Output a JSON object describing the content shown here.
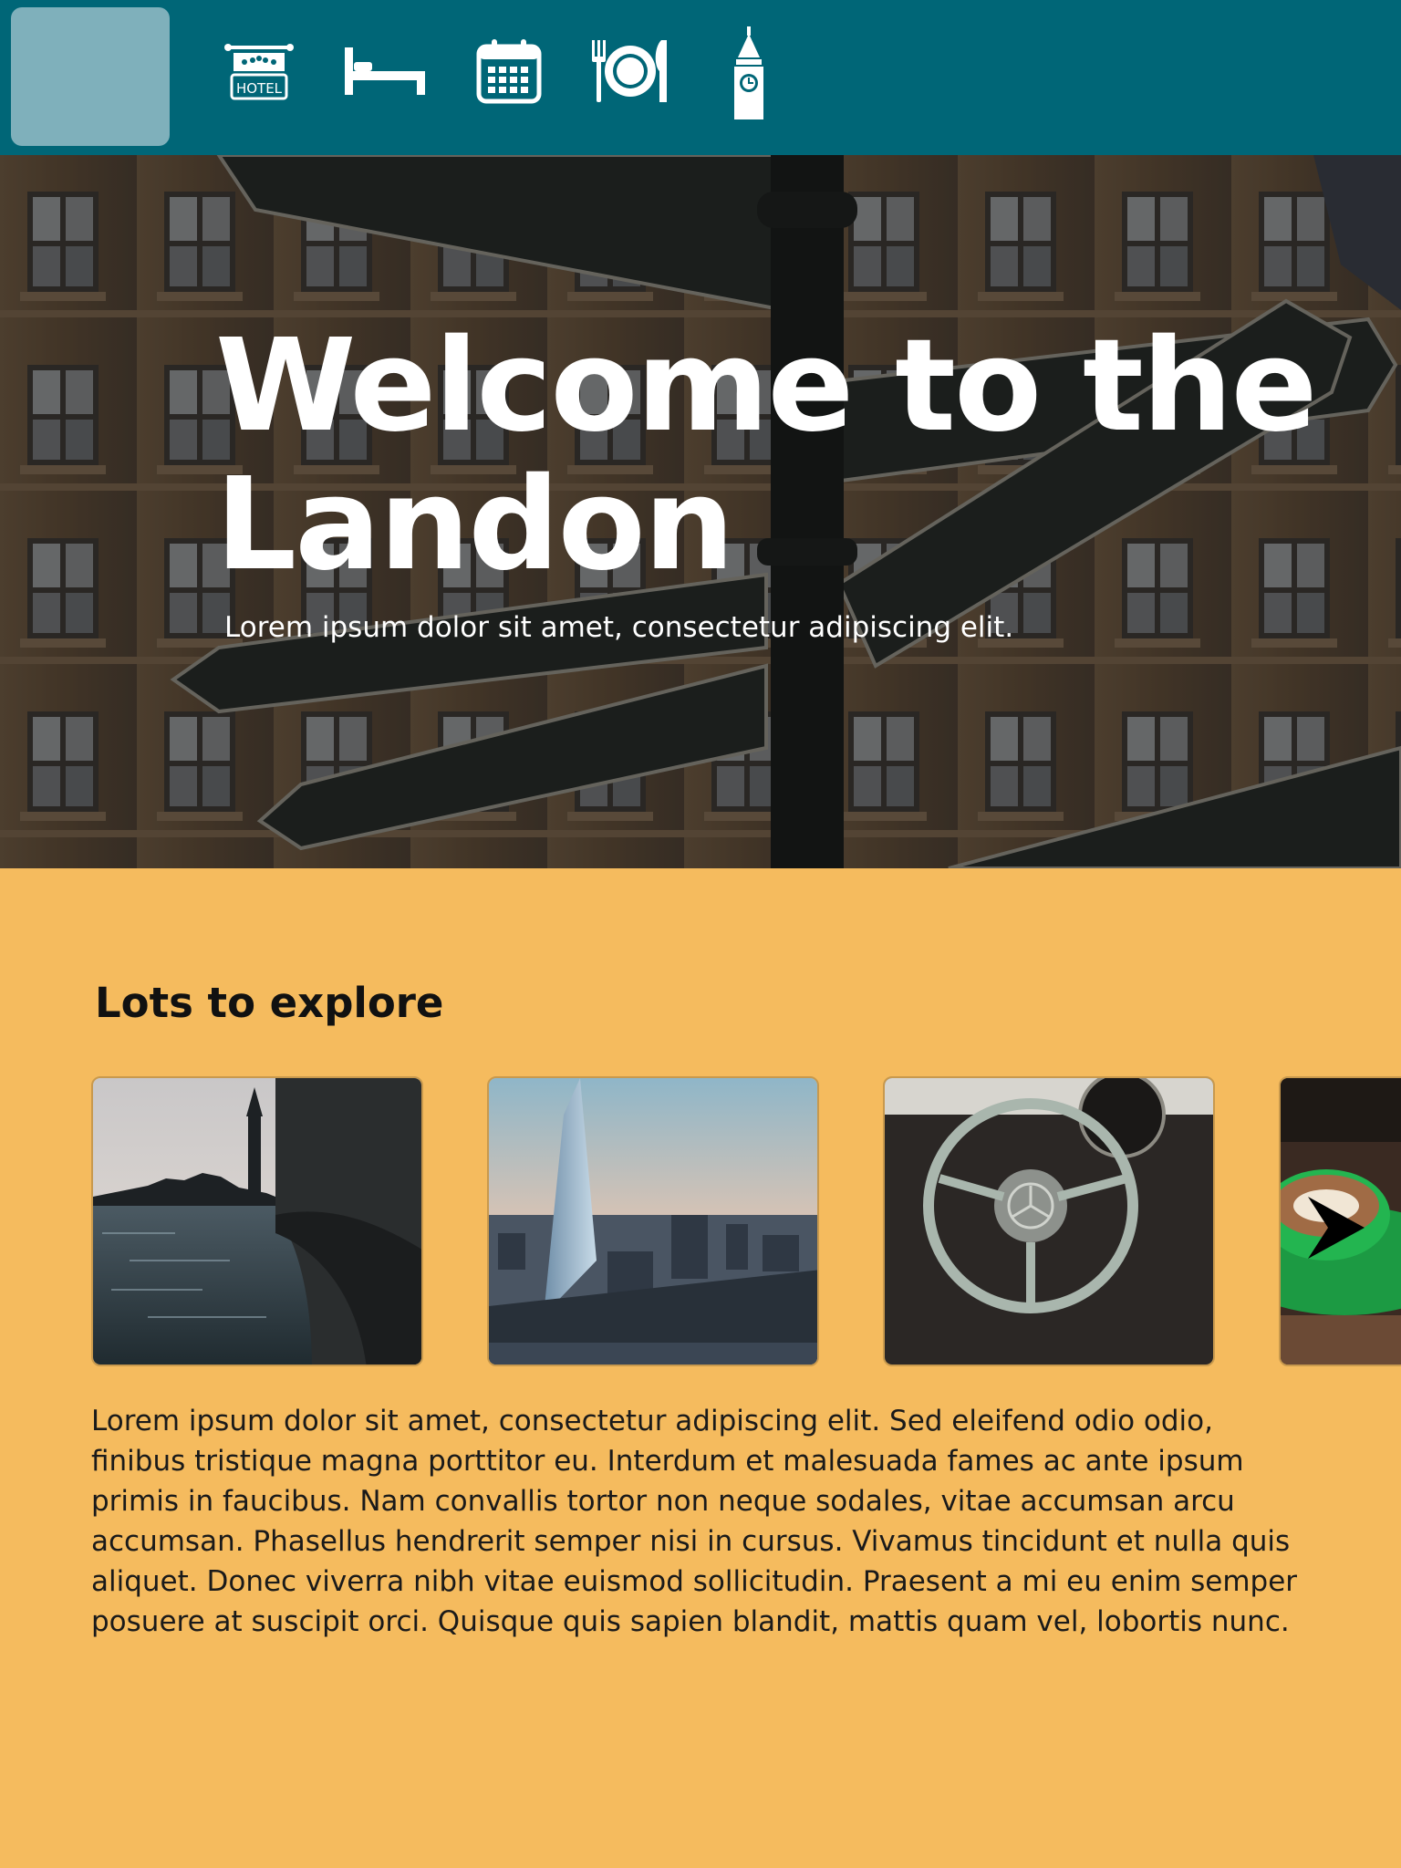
{
  "nav": {
    "icons": [
      {
        "name": "hotel-icon",
        "label": "HOTEL"
      },
      {
        "name": "bed-icon"
      },
      {
        "name": "calendar-icon"
      },
      {
        "name": "dining-icon"
      },
      {
        "name": "big-ben-icon"
      }
    ],
    "colors": {
      "bar": "#006677",
      "logo_placeholder": "#7fb0bb",
      "icon": "#ffffff"
    }
  },
  "hero": {
    "title": "Welcome to the Landon",
    "subtitle": "Lorem ipsum dolor sit amet, consectetur adipiscing elit."
  },
  "explore": {
    "heading": "Lots to explore",
    "cards": [
      {
        "name": "westminster-photo"
      },
      {
        "name": "shard-photo"
      },
      {
        "name": "classic-car-photo"
      },
      {
        "name": "coffee-photo"
      }
    ],
    "next_icon": "chevron-right-icon",
    "paragraph": "Lorem ipsum dolor sit amet, consectetur adipiscing elit. Sed eleifend odio odio, finibus tristique magna porttitor eu. Interdum et malesuada fames ac ante ipsum primis in faucibus. Nam convallis tortor non neque sodales, vitae accumsan arcu accumsan. Phasellus hendrerit semper nisi in cursus. Vivamus tincidunt et nulla quis aliquet. Donec viverra nibh vitae euismod sollicitudin. Praesent a mi eu enim semper posuere at suscipit orci. Quisque quis sapien blandit, mattis quam vel, lobortis nunc."
  },
  "colors": {
    "page_background": "#f5bb5e",
    "text": "#1a1a1a"
  }
}
